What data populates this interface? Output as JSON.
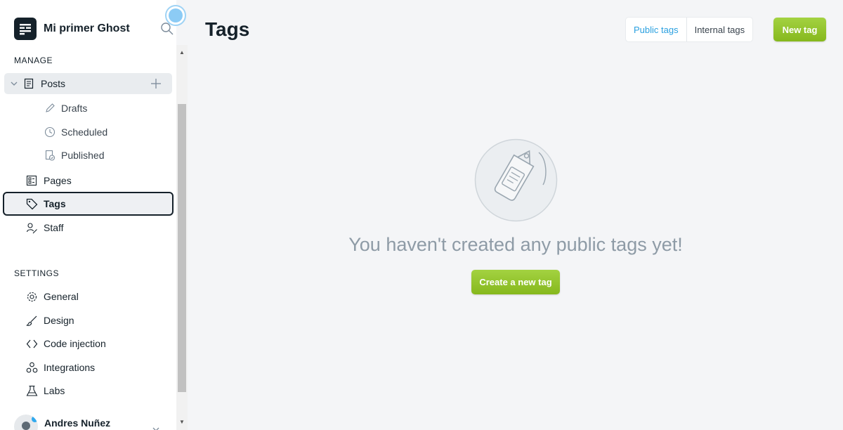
{
  "sidebar": {
    "site_title": "Mi primer Ghost",
    "manage_label": "MANAGE",
    "settings_label": "SETTINGS",
    "posts": {
      "label": "Posts",
      "children": [
        {
          "label": "Drafts",
          "icon": "pencil-icon"
        },
        {
          "label": "Scheduled",
          "icon": "clock-icon"
        },
        {
          "label": "Published",
          "icon": "published-icon"
        }
      ]
    },
    "manage_items": [
      {
        "label": "Pages",
        "icon": "pages-icon"
      },
      {
        "label": "Tags",
        "icon": "tag-icon",
        "active": true
      },
      {
        "label": "Staff",
        "icon": "staff-icon"
      }
    ],
    "settings_items": [
      {
        "label": "General",
        "icon": "gear-icon"
      },
      {
        "label": "Design",
        "icon": "brush-icon"
      },
      {
        "label": "Code injection",
        "icon": "code-icon"
      },
      {
        "label": "Integrations",
        "icon": "integrations-icon"
      },
      {
        "label": "Labs",
        "icon": "flask-icon"
      }
    ],
    "user_name": "Andres Nuñez"
  },
  "main": {
    "title": "Tags",
    "tabs": [
      {
        "label": "Public tags",
        "active": true
      },
      {
        "label": "Internal tags",
        "active": false
      }
    ],
    "new_tag_label": "New tag",
    "empty_message": "You haven't created any public tags yet!",
    "create_button_label": "Create a new tag"
  },
  "colors": {
    "accent_green": "#9fcd3a",
    "tab_active_blue": "#2aa0e0",
    "text_dark": "#15212a",
    "background": "#f4f5f7"
  }
}
